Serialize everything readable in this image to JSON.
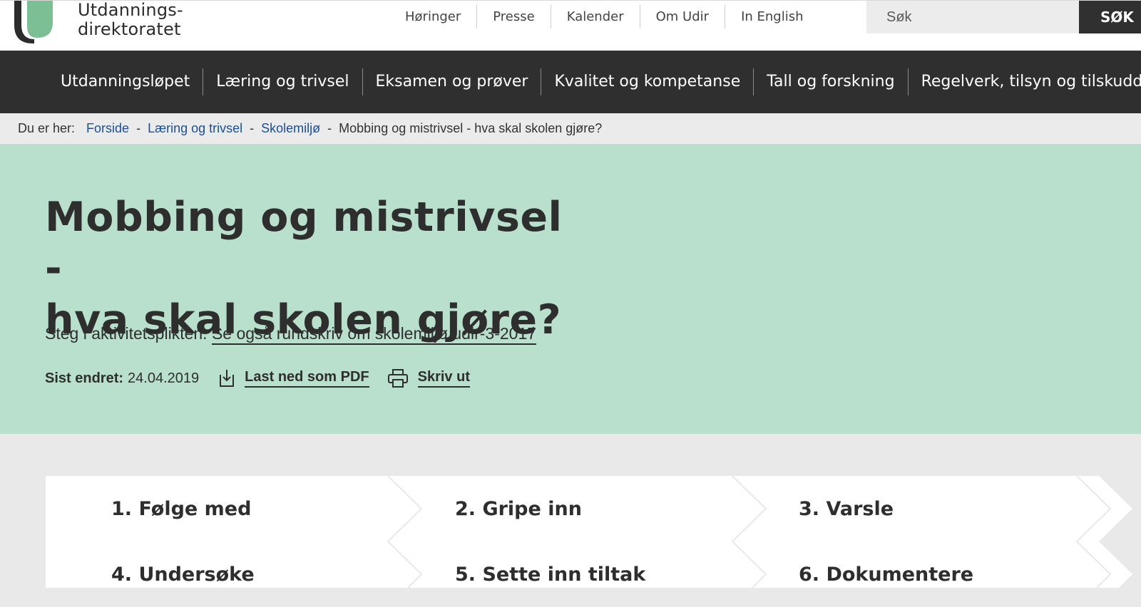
{
  "header": {
    "logo_line1": "Utdannings-",
    "logo_line2": "direktoratet",
    "top_links": [
      "Høringer",
      "Presse",
      "Kalender",
      "Om Udir",
      "In English"
    ],
    "search_placeholder": "Søk",
    "search_button": "SØK"
  },
  "nav": {
    "items": [
      "Utdanningsløpet",
      "Læring og trivsel",
      "Eksamen og prøver",
      "Kvalitet og kompetanse",
      "Tall og forskning",
      "Regelverk, tilsyn og tilskudd"
    ]
  },
  "breadcrumb": {
    "label": "Du er her:",
    "links": [
      "Forside",
      "Læring og trivsel",
      "Skolemiljø"
    ],
    "current": "Mobbing og mistrivsel - hva skal skolen gjøre?",
    "separator": "-"
  },
  "hero": {
    "title_line1": "Mobbing og mistrivsel -",
    "title_line2": "hva skal skolen gjøre?",
    "intro_text": "Steg i aktivitetsplikten.",
    "intro_link": "Se også rundskriv om skolemiljø udir-3-2017",
    "last_changed_label": "Sist endret:",
    "last_changed_date": "24.04.2019",
    "download_pdf": "Last ned som PDF",
    "print": "Skriv ut"
  },
  "steps": [
    "1. Følge med",
    "2. Gripe inn",
    "3. Varsle",
    "4. Undersøke",
    "5. Sette inn tiltak",
    "6. Dokumentere"
  ],
  "colors": {
    "hero_bg": "#b8e0cd",
    "nav_bg": "#2f2f2f",
    "link": "#1d4f91",
    "logo_green": "#7cbf95",
    "logo_dark": "#2c2c2c"
  }
}
